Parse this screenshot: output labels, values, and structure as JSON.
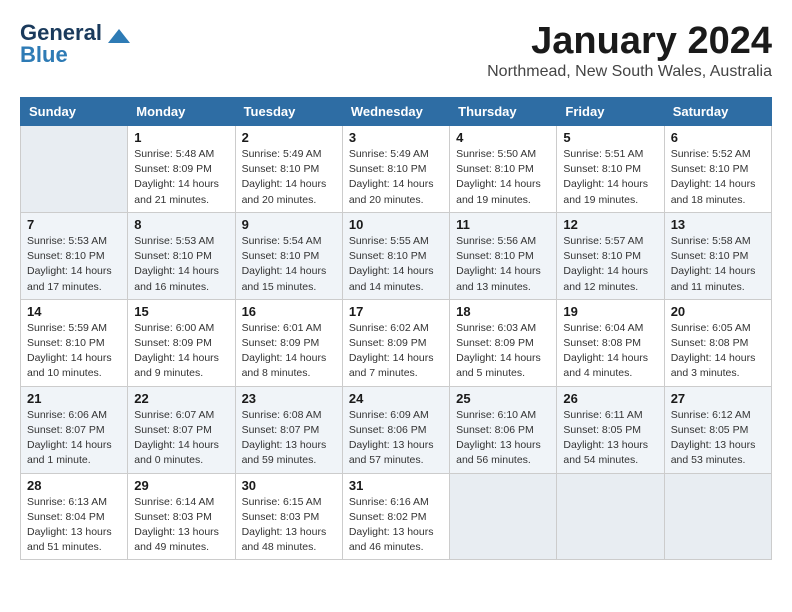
{
  "logo": {
    "part1": "General",
    "part2": "Blue"
  },
  "title": "January 2024",
  "subtitle": "Northmead, New South Wales, Australia",
  "days_of_week": [
    "Sunday",
    "Monday",
    "Tuesday",
    "Wednesday",
    "Thursday",
    "Friday",
    "Saturday"
  ],
  "weeks": [
    [
      {
        "num": "",
        "info": ""
      },
      {
        "num": "1",
        "info": "Sunrise: 5:48 AM\nSunset: 8:09 PM\nDaylight: 14 hours\nand 21 minutes."
      },
      {
        "num": "2",
        "info": "Sunrise: 5:49 AM\nSunset: 8:10 PM\nDaylight: 14 hours\nand 20 minutes."
      },
      {
        "num": "3",
        "info": "Sunrise: 5:49 AM\nSunset: 8:10 PM\nDaylight: 14 hours\nand 20 minutes."
      },
      {
        "num": "4",
        "info": "Sunrise: 5:50 AM\nSunset: 8:10 PM\nDaylight: 14 hours\nand 19 minutes."
      },
      {
        "num": "5",
        "info": "Sunrise: 5:51 AM\nSunset: 8:10 PM\nDaylight: 14 hours\nand 19 minutes."
      },
      {
        "num": "6",
        "info": "Sunrise: 5:52 AM\nSunset: 8:10 PM\nDaylight: 14 hours\nand 18 minutes."
      }
    ],
    [
      {
        "num": "7",
        "info": "Sunrise: 5:53 AM\nSunset: 8:10 PM\nDaylight: 14 hours\nand 17 minutes."
      },
      {
        "num": "8",
        "info": "Sunrise: 5:53 AM\nSunset: 8:10 PM\nDaylight: 14 hours\nand 16 minutes."
      },
      {
        "num": "9",
        "info": "Sunrise: 5:54 AM\nSunset: 8:10 PM\nDaylight: 14 hours\nand 15 minutes."
      },
      {
        "num": "10",
        "info": "Sunrise: 5:55 AM\nSunset: 8:10 PM\nDaylight: 14 hours\nand 14 minutes."
      },
      {
        "num": "11",
        "info": "Sunrise: 5:56 AM\nSunset: 8:10 PM\nDaylight: 14 hours\nand 13 minutes."
      },
      {
        "num": "12",
        "info": "Sunrise: 5:57 AM\nSunset: 8:10 PM\nDaylight: 14 hours\nand 12 minutes."
      },
      {
        "num": "13",
        "info": "Sunrise: 5:58 AM\nSunset: 8:10 PM\nDaylight: 14 hours\nand 11 minutes."
      }
    ],
    [
      {
        "num": "14",
        "info": "Sunrise: 5:59 AM\nSunset: 8:10 PM\nDaylight: 14 hours\nand 10 minutes."
      },
      {
        "num": "15",
        "info": "Sunrise: 6:00 AM\nSunset: 8:09 PM\nDaylight: 14 hours\nand 9 minutes."
      },
      {
        "num": "16",
        "info": "Sunrise: 6:01 AM\nSunset: 8:09 PM\nDaylight: 14 hours\nand 8 minutes."
      },
      {
        "num": "17",
        "info": "Sunrise: 6:02 AM\nSunset: 8:09 PM\nDaylight: 14 hours\nand 7 minutes."
      },
      {
        "num": "18",
        "info": "Sunrise: 6:03 AM\nSunset: 8:09 PM\nDaylight: 14 hours\nand 5 minutes."
      },
      {
        "num": "19",
        "info": "Sunrise: 6:04 AM\nSunset: 8:08 PM\nDaylight: 14 hours\nand 4 minutes."
      },
      {
        "num": "20",
        "info": "Sunrise: 6:05 AM\nSunset: 8:08 PM\nDaylight: 14 hours\nand 3 minutes."
      }
    ],
    [
      {
        "num": "21",
        "info": "Sunrise: 6:06 AM\nSunset: 8:07 PM\nDaylight: 14 hours\nand 1 minute."
      },
      {
        "num": "22",
        "info": "Sunrise: 6:07 AM\nSunset: 8:07 PM\nDaylight: 14 hours\nand 0 minutes."
      },
      {
        "num": "23",
        "info": "Sunrise: 6:08 AM\nSunset: 8:07 PM\nDaylight: 13 hours\nand 59 minutes."
      },
      {
        "num": "24",
        "info": "Sunrise: 6:09 AM\nSunset: 8:06 PM\nDaylight: 13 hours\nand 57 minutes."
      },
      {
        "num": "25",
        "info": "Sunrise: 6:10 AM\nSunset: 8:06 PM\nDaylight: 13 hours\nand 56 minutes."
      },
      {
        "num": "26",
        "info": "Sunrise: 6:11 AM\nSunset: 8:05 PM\nDaylight: 13 hours\nand 54 minutes."
      },
      {
        "num": "27",
        "info": "Sunrise: 6:12 AM\nSunset: 8:05 PM\nDaylight: 13 hours\nand 53 minutes."
      }
    ],
    [
      {
        "num": "28",
        "info": "Sunrise: 6:13 AM\nSunset: 8:04 PM\nDaylight: 13 hours\nand 51 minutes."
      },
      {
        "num": "29",
        "info": "Sunrise: 6:14 AM\nSunset: 8:03 PM\nDaylight: 13 hours\nand 49 minutes."
      },
      {
        "num": "30",
        "info": "Sunrise: 6:15 AM\nSunset: 8:03 PM\nDaylight: 13 hours\nand 48 minutes."
      },
      {
        "num": "31",
        "info": "Sunrise: 6:16 AM\nSunset: 8:02 PM\nDaylight: 13 hours\nand 46 minutes."
      },
      {
        "num": "",
        "info": ""
      },
      {
        "num": "",
        "info": ""
      },
      {
        "num": "",
        "info": ""
      }
    ]
  ]
}
